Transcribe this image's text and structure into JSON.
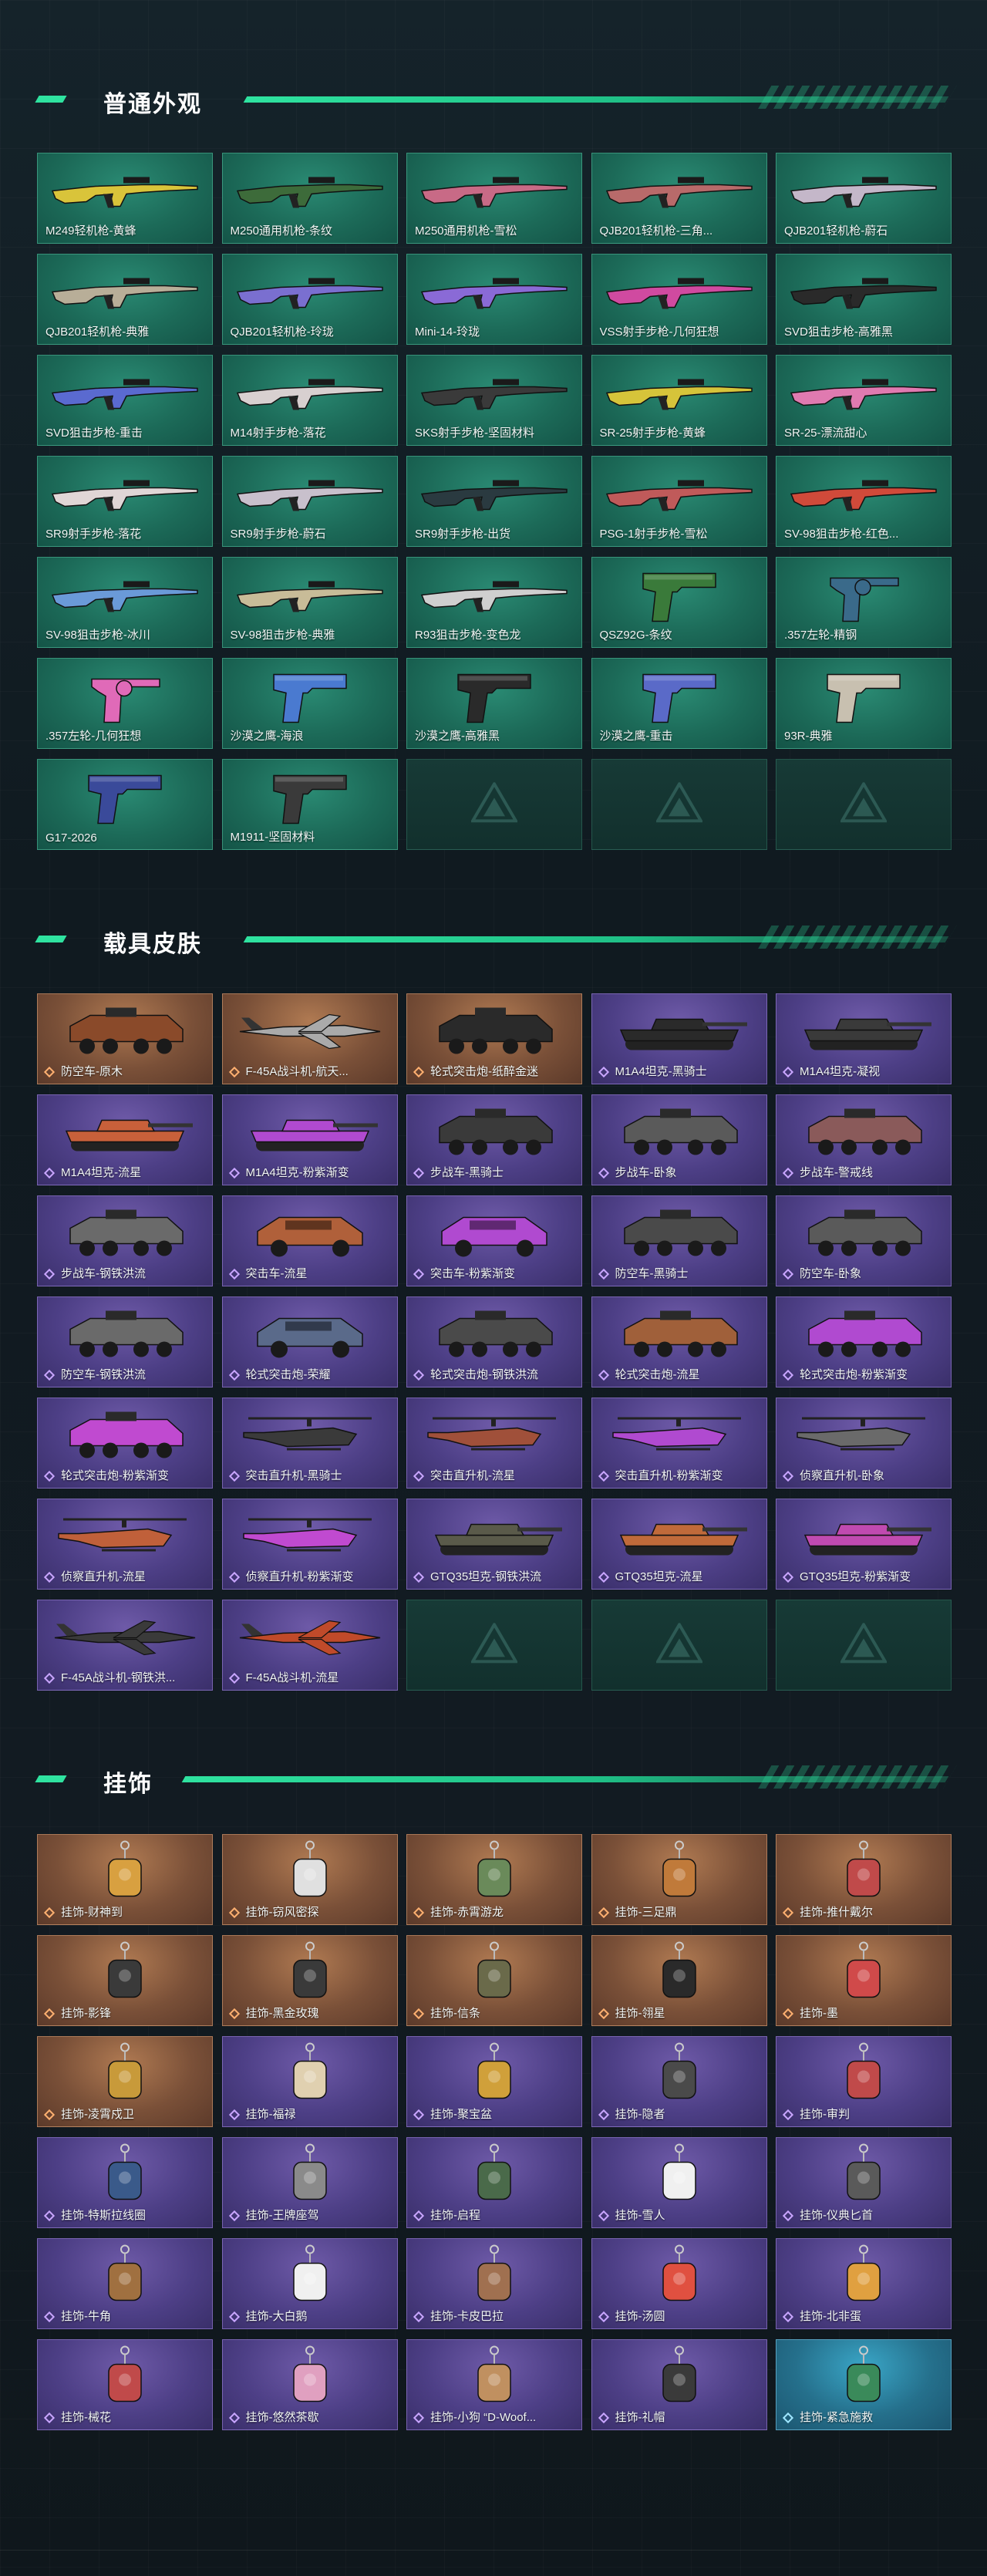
{
  "sections": [
    {
      "title": "普通外观",
      "items": [
        {
          "label": "M249轻机枪-黄蜂",
          "kind": "rifle",
          "color": "#d9c43a",
          "rarity": "teal"
        },
        {
          "label": "M250通用机枪-条纹",
          "kind": "rifle",
          "color": "#3d6b3a",
          "rarity": "teal"
        },
        {
          "label": "M250通用机枪-雪松",
          "kind": "rifle",
          "color": "#c86a86",
          "rarity": "teal"
        },
        {
          "label": "QJB201轻机枪-三角...",
          "kind": "rifle",
          "color": "#b86a6a",
          "rarity": "teal"
        },
        {
          "label": "QJB201轻机枪-蔚石",
          "kind": "rifle",
          "color": "#c4b7c9",
          "rarity": "teal"
        },
        {
          "label": "QJB201轻机枪-典雅",
          "kind": "rifle",
          "color": "#b8ae98",
          "rarity": "teal"
        },
        {
          "label": "QJB201轻机枪-玲珑",
          "kind": "rifle",
          "color": "#7a6fd0",
          "rarity": "teal"
        },
        {
          "label": "Mini-14-玲珑",
          "kind": "rifle",
          "color": "#8a6ad6",
          "rarity": "teal"
        },
        {
          "label": "VSS射手步枪-几何狂想",
          "kind": "rifle",
          "color": "#d04aa0",
          "rarity": "teal"
        },
        {
          "label": "SVD狙击步枪-高雅黑",
          "kind": "rifle",
          "color": "#2a2a2a",
          "rarity": "teal"
        },
        {
          "label": "SVD狙击步枪-重击",
          "kind": "rifle",
          "color": "#5a6ad0",
          "rarity": "teal"
        },
        {
          "label": "M14射手步枪-落花",
          "kind": "rifle",
          "color": "#d8d0d0",
          "rarity": "teal"
        },
        {
          "label": "SKS射手步枪-坚固材料",
          "kind": "rifle",
          "color": "#3a3a3a",
          "rarity": "teal"
        },
        {
          "label": "SR-25射手步枪-黄蜂",
          "kind": "rifle",
          "color": "#d6c43a",
          "rarity": "teal"
        },
        {
          "label": "SR-25-漂流甜心",
          "kind": "rifle",
          "color": "#e07ab0",
          "rarity": "teal"
        },
        {
          "label": "SR9射手步枪-落花",
          "kind": "rifle",
          "color": "#e0d6d6",
          "rarity": "teal"
        },
        {
          "label": "SR9射手步枪-蔚石",
          "kind": "rifle",
          "color": "#c8c0cc",
          "rarity": "teal"
        },
        {
          "label": "SR9射手步枪-出货",
          "kind": "rifle",
          "color": "#2a3a40",
          "rarity": "teal"
        },
        {
          "label": "PSG-1射手步枪-雪松",
          "kind": "rifle",
          "color": "#c05a5a",
          "rarity": "teal"
        },
        {
          "label": "SV-98狙击步枪-红色...",
          "kind": "rifle",
          "color": "#d04a3a",
          "rarity": "teal"
        },
        {
          "label": "SV-98狙击步枪-冰川",
          "kind": "rifle",
          "color": "#6a9ad8",
          "rarity": "teal"
        },
        {
          "label": "SV-98狙击步枪-典雅",
          "kind": "rifle",
          "color": "#c8bc98",
          "rarity": "teal"
        },
        {
          "label": "R93狙击步枪-变色龙",
          "kind": "rifle",
          "color": "#cfcfcf",
          "rarity": "teal"
        },
        {
          "label": "QSZ92G-条纹",
          "kind": "pistol",
          "color": "#3a7a3a",
          "rarity": "teal"
        },
        {
          "label": ".357左轮-精钢",
          "kind": "revolver",
          "color": "#3a6a8a",
          "rarity": "teal"
        },
        {
          "label": ".357左轮-几何狂想",
          "kind": "revolver",
          "color": "#e06ab8",
          "rarity": "teal"
        },
        {
          "label": "沙漠之鹰-海浪",
          "kind": "pistol",
          "color": "#4a7ad0",
          "rarity": "teal"
        },
        {
          "label": "沙漠之鹰-高雅黑",
          "kind": "pistol",
          "color": "#2a2a2a",
          "rarity": "teal"
        },
        {
          "label": "沙漠之鹰-重击",
          "kind": "pistol",
          "color": "#5a6ac8",
          "rarity": "teal"
        },
        {
          "label": "93R-典雅",
          "kind": "pistol",
          "color": "#c8c0b0",
          "rarity": "teal"
        },
        {
          "label": "G17-2026",
          "kind": "pistol",
          "color": "#3a4a9a",
          "rarity": "teal"
        },
        {
          "label": "M1911-坚固材料",
          "kind": "pistol",
          "color": "#3a3a3a",
          "rarity": "teal"
        },
        {
          "label": "",
          "kind": "empty",
          "color": "",
          "rarity": "empty"
        },
        {
          "label": "",
          "kind": "empty",
          "color": "",
          "rarity": "empty"
        },
        {
          "label": "",
          "kind": "empty",
          "color": "",
          "rarity": "empty"
        }
      ]
    },
    {
      "title": "载具皮肤",
      "items": [
        {
          "label": "防空车-原木",
          "kind": "apc",
          "color": "#8a4a2a",
          "rarity": "orange"
        },
        {
          "label": "F-45A战斗机-航天...",
          "kind": "jet",
          "color": "#aaaaaa",
          "rarity": "orange"
        },
        {
          "label": "轮式突击炮-纸醉金迷",
          "kind": "apc",
          "color": "#2a2a2a",
          "rarity": "orange"
        },
        {
          "label": "M1A4坦克-黑骑士",
          "kind": "tank",
          "color": "#2a2a2a",
          "rarity": "purple"
        },
        {
          "label": "M1A4坦克-凝视",
          "kind": "tank",
          "color": "#3a3a3a",
          "rarity": "purple"
        },
        {
          "label": "M1A4坦克-流星",
          "kind": "tank",
          "color": "#c8603a",
          "rarity": "purple"
        },
        {
          "label": "M1A4坦克-粉紫渐变",
          "kind": "tank",
          "color": "#b04ad0",
          "rarity": "purple"
        },
        {
          "label": "步战车-黑骑士",
          "kind": "apc",
          "color": "#3a3a3a",
          "rarity": "purple"
        },
        {
          "label": "步战车-卧象",
          "kind": "apc",
          "color": "#5a5a5a",
          "rarity": "purple"
        },
        {
          "label": "步战车-警戒线",
          "kind": "apc",
          "color": "#8a5a5a",
          "rarity": "purple"
        },
        {
          "label": "步战车-钢铁洪流",
          "kind": "apc",
          "color": "#6a6a6a",
          "rarity": "purple"
        },
        {
          "label": "突击车-流星",
          "kind": "car",
          "color": "#b0603a",
          "rarity": "purple"
        },
        {
          "label": "突击车-粉紫渐变",
          "kind": "car",
          "color": "#b04ad0",
          "rarity": "purple"
        },
        {
          "label": "防空车-黑骑士",
          "kind": "apc",
          "color": "#4a4a4a",
          "rarity": "purple"
        },
        {
          "label": "防空车-卧象",
          "kind": "apc",
          "color": "#5a5a5a",
          "rarity": "purple"
        },
        {
          "label": "防空车-钢铁洪流",
          "kind": "apc",
          "color": "#6a6a6a",
          "rarity": "purple"
        },
        {
          "label": "轮式突击炮-荣耀",
          "kind": "car",
          "color": "#5a6a8a",
          "rarity": "purple"
        },
        {
          "label": "轮式突击炮-钢铁洪流",
          "kind": "apc",
          "color": "#4a4a4a",
          "rarity": "purple"
        },
        {
          "label": "轮式突击炮-流星",
          "kind": "apc",
          "color": "#a0603a",
          "rarity": "purple"
        },
        {
          "label": "轮式突击炮-粉紫渐变",
          "kind": "apc",
          "color": "#b04ad0",
          "rarity": "purple"
        },
        {
          "label": "轮式突击炮-粉紫渐变",
          "kind": "apc",
          "color": "#c04ad0",
          "rarity": "purple"
        },
        {
          "label": "突击直升机-黑骑士",
          "kind": "heli",
          "color": "#3a3a3a",
          "rarity": "purple"
        },
        {
          "label": "突击直升机-流星",
          "kind": "heli",
          "color": "#a0503a",
          "rarity": "purple"
        },
        {
          "label": "突击直升机-粉紫渐变",
          "kind": "heli",
          "color": "#b04ad0",
          "rarity": "purple"
        },
        {
          "label": "侦察直升机-卧象",
          "kind": "heli",
          "color": "#6a6a6a",
          "rarity": "purple"
        },
        {
          "label": "侦察直升机-流星",
          "kind": "heli",
          "color": "#c0603a",
          "rarity": "purple"
        },
        {
          "label": "侦察直升机-粉紫渐变",
          "kind": "heli",
          "color": "#c04ad0",
          "rarity": "purple"
        },
        {
          "label": "GTQ35坦克-钢铁洪流",
          "kind": "tank",
          "color": "#5a5a4a",
          "rarity": "purple"
        },
        {
          "label": "GTQ35坦克-流星",
          "kind": "tank",
          "color": "#c06a3a",
          "rarity": "purple"
        },
        {
          "label": "GTQ35坦克-粉紫渐变",
          "kind": "tank",
          "color": "#c04ab0",
          "rarity": "purple"
        },
        {
          "label": "F-45A战斗机-钢铁洪...",
          "kind": "jet",
          "color": "#3a3a3a",
          "rarity": "purple"
        },
        {
          "label": "F-45A战斗机-流星",
          "kind": "jet",
          "color": "#c04a2a",
          "rarity": "purple"
        },
        {
          "label": "",
          "kind": "empty",
          "color": "",
          "rarity": "empty"
        },
        {
          "label": "",
          "kind": "empty",
          "color": "",
          "rarity": "empty"
        },
        {
          "label": "",
          "kind": "empty",
          "color": "",
          "rarity": "empty"
        }
      ]
    },
    {
      "title": "挂饰",
      "items": [
        {
          "label": "挂饰-财神到",
          "kind": "charm",
          "color": "#d8a040",
          "rarity": "orange"
        },
        {
          "label": "挂饰-窃风密探",
          "kind": "charm",
          "color": "#e0e0e0",
          "rarity": "orange"
        },
        {
          "label": "挂饰-赤霄游龙",
          "kind": "charm",
          "color": "#6a8a5a",
          "rarity": "orange"
        },
        {
          "label": "挂饰-三足鼎",
          "kind": "charm",
          "color": "#c07a3a",
          "rarity": "orange"
        },
        {
          "label": "挂饰-推什戴尔",
          "kind": "charm",
          "color": "#c04a4a",
          "rarity": "orange"
        },
        {
          "label": "挂饰-影锋",
          "kind": "charm",
          "color": "#3a3a3a",
          "rarity": "orange"
        },
        {
          "label": "挂饰-黑金玫瑰",
          "kind": "charm",
          "color": "#3a3a3a",
          "rarity": "orange"
        },
        {
          "label": "挂饰-信条",
          "kind": "charm",
          "color": "#6a6a4a",
          "rarity": "orange"
        },
        {
          "label": "挂饰-翎星",
          "kind": "charm",
          "color": "#2a2a2a",
          "rarity": "orange"
        },
        {
          "label": "挂饰-墨",
          "kind": "charm",
          "color": "#d04a4a",
          "rarity": "orange"
        },
        {
          "label": "挂饰-凌霄戍卫",
          "kind": "charm",
          "color": "#c89a3a",
          "rarity": "orange"
        },
        {
          "label": "挂饰-福禄",
          "kind": "charm",
          "color": "#e0d0b0",
          "rarity": "purple"
        },
        {
          "label": "挂饰-聚宝盆",
          "kind": "charm",
          "color": "#d0a03a",
          "rarity": "purple"
        },
        {
          "label": "挂饰-隐者",
          "kind": "charm",
          "color": "#4a4a4a",
          "rarity": "purple"
        },
        {
          "label": "挂饰-审判",
          "kind": "charm",
          "color": "#c04a4a",
          "rarity": "purple"
        },
        {
          "label": "挂饰-特斯拉线圈",
          "kind": "charm",
          "color": "#3a5a8a",
          "rarity": "purple"
        },
        {
          "label": "挂饰-王牌座驾",
          "kind": "charm",
          "color": "#8a8a8a",
          "rarity": "purple"
        },
        {
          "label": "挂饰-启程",
          "kind": "charm",
          "color": "#4a6a4a",
          "rarity": "purple"
        },
        {
          "label": "挂饰-雪人",
          "kind": "charm",
          "color": "#f0f0f0",
          "rarity": "purple"
        },
        {
          "label": "挂饰-仪典匕首",
          "kind": "charm",
          "color": "#5a5a5a",
          "rarity": "purple"
        },
        {
          "label": "挂饰-牛角",
          "kind": "charm",
          "color": "#a07040",
          "rarity": "purple"
        },
        {
          "label": "挂饰-大白鹅",
          "kind": "charm",
          "color": "#f0f0f0",
          "rarity": "purple"
        },
        {
          "label": "挂饰-卡皮巴拉",
          "kind": "charm",
          "color": "#a07050",
          "rarity": "purple"
        },
        {
          "label": "挂饰-汤圆",
          "kind": "charm",
          "color": "#e05040",
          "rarity": "purple"
        },
        {
          "label": "挂饰-北非蛋",
          "kind": "charm",
          "color": "#e0a040",
          "rarity": "purple"
        },
        {
          "label": "挂饰-械花",
          "kind": "charm",
          "color": "#c04a4a",
          "rarity": "purple"
        },
        {
          "label": "挂饰-悠然茶歇",
          "kind": "charm",
          "color": "#e0a0c0",
          "rarity": "purple"
        },
        {
          "label": "挂饰-小狗 “D-Woof...",
          "kind": "charm",
          "color": "#c09060",
          "rarity": "purple"
        },
        {
          "label": "挂饰-礼帽",
          "kind": "charm",
          "color": "#3a3a3a",
          "rarity": "purple"
        },
        {
          "label": "挂饰-紧急施救",
          "kind": "charm",
          "color": "#3a8a5a",
          "rarity": "blue"
        }
      ]
    }
  ],
  "watermark_icon": "logo-triangle-icon",
  "rarity_icon": "diamond-icon"
}
